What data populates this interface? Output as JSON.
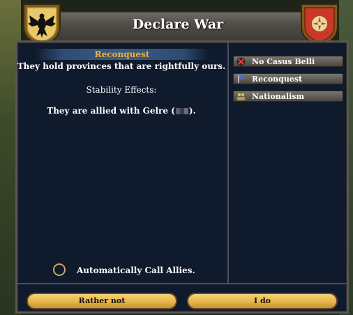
{
  "dialog": {
    "title": "Declare War"
  },
  "casus_belli": {
    "selected_title": "Reconquest",
    "description": "They hold provinces that are rightfully ours.",
    "stability_label": "Stability Effects:",
    "alliance_prefix": "They are allied with Gelre (",
    "alliance_suffix": ")."
  },
  "cb_list": [
    {
      "label": "No Casus Belli",
      "icon": "cross-icon"
    },
    {
      "label": "Reconquest",
      "icon": "banner-icon"
    },
    {
      "label": "Nationalism",
      "icon": "crowd-icon"
    }
  ],
  "options": {
    "call_allies_label": "Automatically Call Allies."
  },
  "buttons": {
    "cancel_label": "Rather not",
    "confirm_label": "I do"
  }
}
